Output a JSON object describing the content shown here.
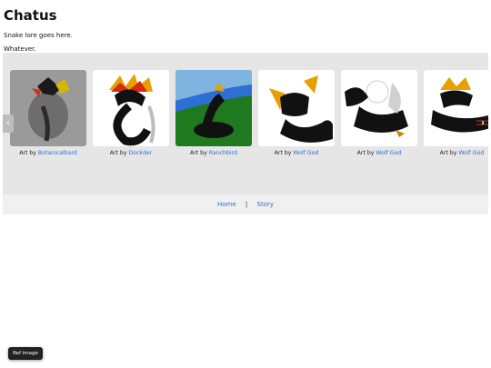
{
  "page": {
    "title": "Chatus",
    "lore": "Snake lore goes here.",
    "whatever": "Whatever."
  },
  "gallery": {
    "prev_icon": "‹",
    "next_icon": "›",
    "cards": [
      {
        "prefix": "Art by",
        "artist": "Botanicalbard"
      },
      {
        "prefix": "Art by",
        "artist": "Dockder"
      },
      {
        "prefix": "Art by",
        "artist": "Ranchbird"
      },
      {
        "prefix": "Art by",
        "artist": "Wolf God"
      },
      {
        "prefix": "Art by",
        "artist": "Wolf God"
      },
      {
        "prefix": "Art by",
        "artist": "Wolf God"
      }
    ]
  },
  "footer": {
    "home": "Home",
    "separator": "|",
    "story": "Story"
  },
  "ref_button": "Ref image",
  "colors": {
    "link": "#2a6ed1",
    "gallery_bg": "#e6e6e6",
    "footer_bg": "#f0f0f0"
  }
}
